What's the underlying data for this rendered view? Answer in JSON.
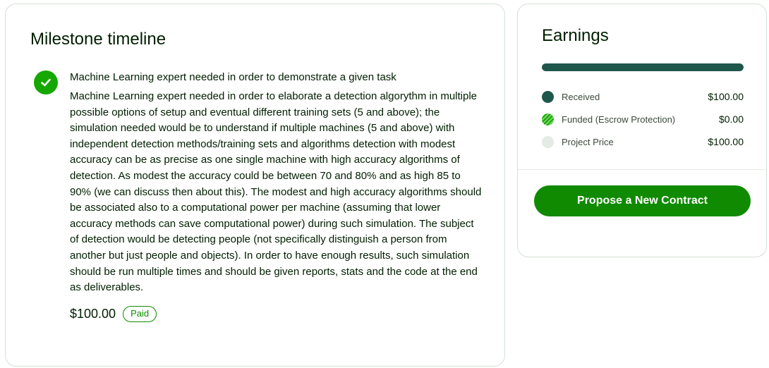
{
  "milestone_timeline": {
    "title": "Milestone timeline",
    "milestone": {
      "status_icon": "check-icon",
      "title": "Machine Learning expert needed in order to demonstrate a given task",
      "description": "Machine Learning expert needed in order to elaborate a detection algorythm in multiple possible options of setup and eventual different training sets (5 and above); the simulation needed would be to understand if multiple machines (5 and above) with independent detection methods/training sets and algorithms detection with modest accuracy can be as precise as one single machine with high accuracy algorithms of detection. As modest the accuracy could be between 70 and 80% and as high 85 to 90% (we can discuss then about this). The modest and high accuracy algorithms should be associated also to a computational power per machine (assuming that lower accuracy methods can save computational power) during such simulation. The subject of detection would be detecting people (not specifically distinguish a person from another but just people and objects). In order to have enough results, such simulation should be run multiple times and should be given reports, stats and the code at the end as deliverables.",
      "amount": "$100.00",
      "status": "Paid"
    }
  },
  "earnings": {
    "title": "Earnings",
    "progress_fraction": 1.0,
    "legend": [
      {
        "label": "Received",
        "value": "$100.00",
        "color": "#1f574d"
      },
      {
        "label": "Funded (Escrow Protection)",
        "value": "$0.00",
        "color": "#14a800"
      },
      {
        "label": "Project Price",
        "value": "$100.00",
        "color": "#e4ebe4"
      }
    ],
    "propose_button_label": "Propose a New Contract"
  },
  "colors": {
    "brand_green": "#108a00",
    "dark_green": "#1f574d",
    "light_gray": "#e4ebe4"
  }
}
